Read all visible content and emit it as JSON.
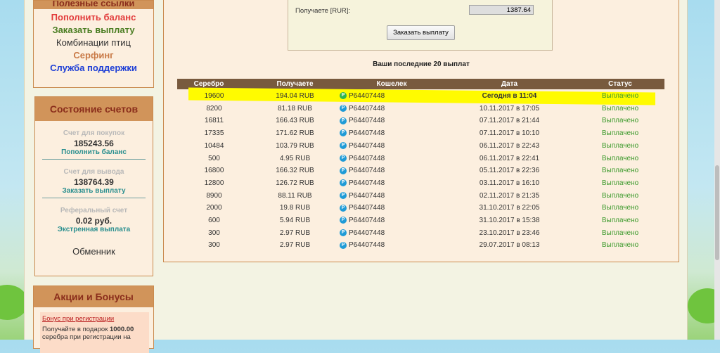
{
  "sidebar": {
    "links": {
      "title": "Полезные ссылки",
      "items": [
        {
          "label": "Пополнить баланс",
          "color": "#e23b3b"
        },
        {
          "label": "Заказать выплату",
          "color": "#4a7d22"
        },
        {
          "label": "Комбинации птиц",
          "color": "#333333"
        },
        {
          "label": "Серфинг",
          "color": "#c97a47"
        },
        {
          "label": "Служба поддержки",
          "color": "#1e3fd6"
        }
      ]
    },
    "accounts": {
      "title": "Состояние счетов",
      "items": [
        {
          "label": "Счет для покупок",
          "value": "185243.56",
          "link": "Пополнить баланс"
        },
        {
          "label": "Счет для вывода",
          "value": "138764.39",
          "link": "Заказать выплату"
        },
        {
          "label": "Реферальный счет",
          "value": "0.02 руб.",
          "link": "Экстренная выплата"
        }
      ],
      "exchanger": "Обменник"
    },
    "promo": {
      "title": "Акции и Бонусы",
      "link": "Бонус при регистрации",
      "text_1": "Получайте в подарок ",
      "text_bold": "1000.00",
      "text_2": "серебра при регистрации на"
    }
  },
  "form": {
    "label": "Получаете [RUR]:",
    "value": "1387.64",
    "button": "Заказать выплату"
  },
  "table": {
    "title": "Ваши последние 20 выплат",
    "headers": [
      "Серебро",
      "Получаете",
      "Кошелек",
      "Дата",
      "Статус"
    ],
    "rows": [
      {
        "silver": "19600",
        "receive": "194.04 RUB",
        "wallet": "P64407448",
        "date": "Сегодня в 11:04",
        "status": "Выплачено"
      },
      {
        "silver": "8200",
        "receive": "81.18 RUB",
        "wallet": "P64407448",
        "date": "10.11.2017 в 17:05",
        "status": "Выплачено"
      },
      {
        "silver": "16811",
        "receive": "166.43 RUB",
        "wallet": "P64407448",
        "date": "07.11.2017 в 21:44",
        "status": "Выплачено"
      },
      {
        "silver": "17335",
        "receive": "171.62 RUB",
        "wallet": "P64407448",
        "date": "07.11.2017 в 10:10",
        "status": "Выплачено"
      },
      {
        "silver": "10484",
        "receive": "103.79 RUB",
        "wallet": "P64407448",
        "date": "06.11.2017 в 22:43",
        "status": "Выплачено"
      },
      {
        "silver": "500",
        "receive": "4.95 RUB",
        "wallet": "P64407448",
        "date": "06.11.2017 в 22:41",
        "status": "Выплачено"
      },
      {
        "silver": "16800",
        "receive": "166.32 RUB",
        "wallet": "P64407448",
        "date": "05.11.2017 в 22:36",
        "status": "Выплачено"
      },
      {
        "silver": "12800",
        "receive": "126.72 RUB",
        "wallet": "P64407448",
        "date": "03.11.2017 в 16:10",
        "status": "Выплачено"
      },
      {
        "silver": "8900",
        "receive": "88.11 RUB",
        "wallet": "P64407448",
        "date": "02.11.2017 в 21:35",
        "status": "Выплачено"
      },
      {
        "silver": "2000",
        "receive": "19.8 RUB",
        "wallet": "P64407448",
        "date": "31.10.2017 в 22:05",
        "status": "Выплачено"
      },
      {
        "silver": "600",
        "receive": "5.94 RUB",
        "wallet": "P64407448",
        "date": "31.10.2017 в 15:38",
        "status": "Выплачено"
      },
      {
        "silver": "300",
        "receive": "2.97 RUB",
        "wallet": "P64407448",
        "date": "23.10.2017 в 23:46",
        "status": "Выплачено"
      },
      {
        "silver": "300",
        "receive": "2.97 RUB",
        "wallet": "P64407448",
        "date": "29.07.2017 в 08:13",
        "status": "Выплачено"
      }
    ]
  }
}
